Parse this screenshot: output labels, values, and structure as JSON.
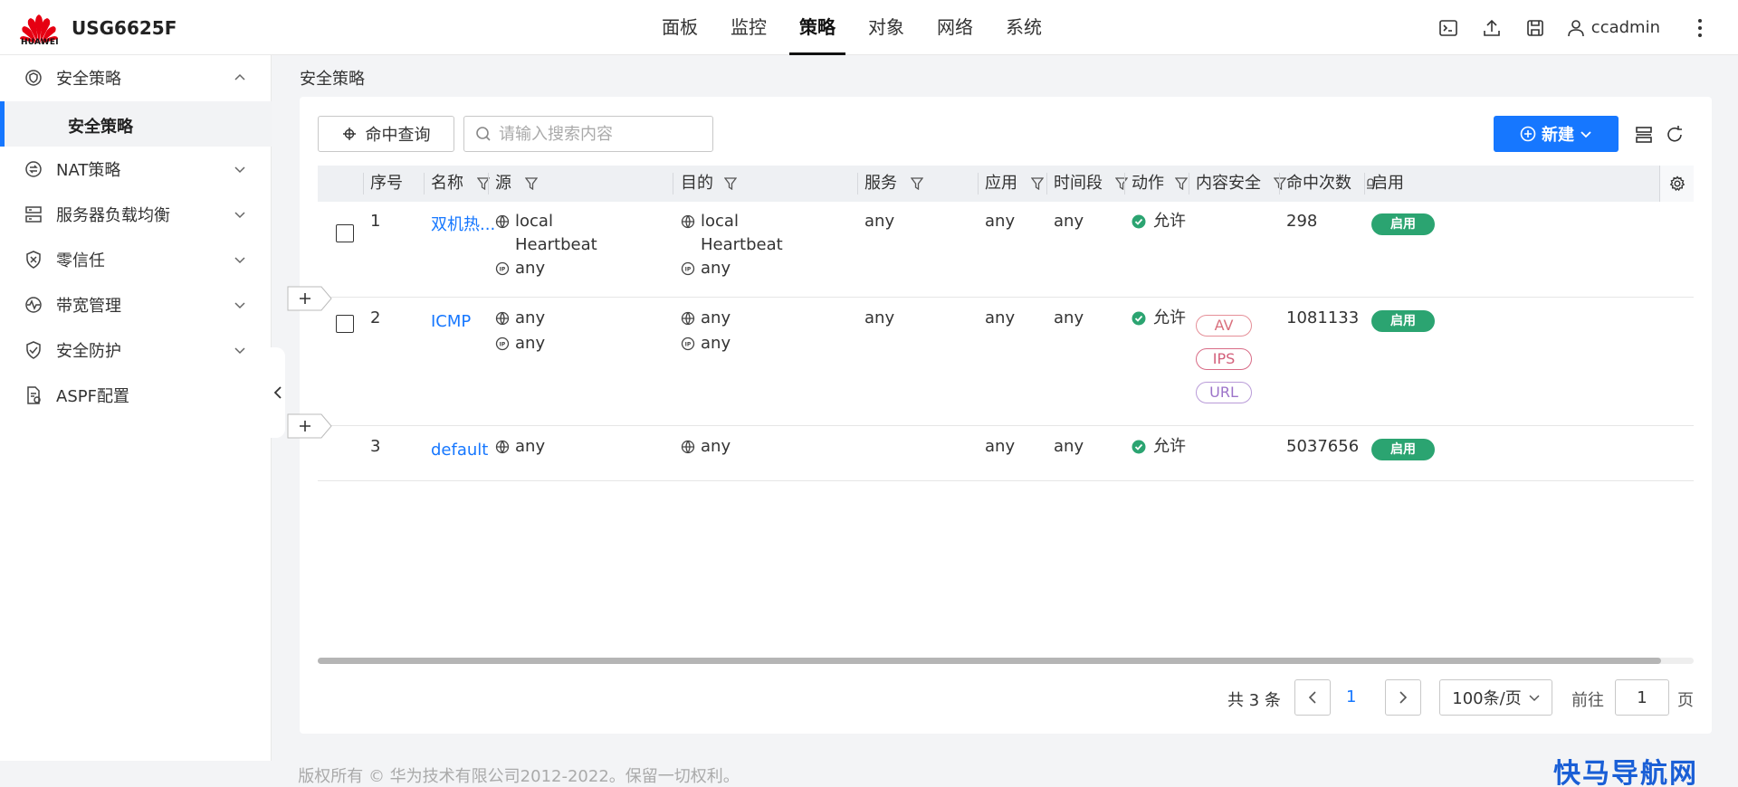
{
  "header": {
    "logo_text": "HUAWEI",
    "device_name": "USG6625F",
    "nav": [
      {
        "label": "面板",
        "active": false
      },
      {
        "label": "监控",
        "active": false
      },
      {
        "label": "策略",
        "active": true
      },
      {
        "label": "对象",
        "active": false
      },
      {
        "label": "网络",
        "active": false
      },
      {
        "label": "系统",
        "active": false
      }
    ],
    "icons": [
      "terminal-icon",
      "upload-icon",
      "save-icon",
      "user-icon",
      "more-vertical-icon"
    ],
    "username": "ccadmin"
  },
  "sidebar": {
    "items": [
      {
        "label": "安全策略",
        "icon": "security-policy-icon",
        "expanded": true
      },
      {
        "label": "NAT策略",
        "icon": "nat-icon",
        "expanded": false
      },
      {
        "label": "服务器负载均衡",
        "icon": "server-lb-icon",
        "expanded": false
      },
      {
        "label": "零信任",
        "icon": "zero-trust-icon",
        "expanded": false
      },
      {
        "label": "带宽管理",
        "icon": "bandwidth-icon",
        "expanded": false
      },
      {
        "label": "安全防护",
        "icon": "shield-check-icon",
        "expanded": false
      },
      {
        "label": "ASPF配置",
        "icon": "aspf-icon",
        "expanded": null
      }
    ],
    "active_sub": "安全策略"
  },
  "breadcrumb": "安全策略",
  "toolbar": {
    "hit_query_label": "命中查询",
    "search_placeholder": "请输入搜索内容",
    "new_label": "新建"
  },
  "table": {
    "columns": [
      "序号",
      "名称",
      "源",
      "目的",
      "服务",
      "应用",
      "时间段",
      "动作",
      "内容安全",
      "命中次数",
      "启用"
    ],
    "rows": [
      {
        "index": "1",
        "name": "双机热...",
        "source": [
          "local",
          "Heartbeat",
          "any"
        ],
        "destination": [
          "local",
          "Heartbeat",
          "any"
        ],
        "service": "any",
        "application": "any",
        "time_range": "any",
        "action": "允许",
        "content_security": [],
        "hits": "298",
        "enabled": "启用"
      },
      {
        "index": "2",
        "name": "ICMP",
        "source": [
          "any",
          "any"
        ],
        "destination": [
          "any",
          "any"
        ],
        "service": "any",
        "application": "any",
        "time_range": "any",
        "action": "允许",
        "content_security": [
          "AV",
          "IPS",
          "URL"
        ],
        "hits": "1081133",
        "enabled": "启用"
      },
      {
        "index": "3",
        "name": "default",
        "source": [
          "any"
        ],
        "destination": [
          "any"
        ],
        "service": "",
        "application": "any",
        "time_range": "any",
        "action": "允许",
        "content_security": [],
        "hits": "5037656",
        "enabled": "启用"
      }
    ]
  },
  "pagination": {
    "total_text": "共 3 条",
    "current_page": "1",
    "page_size": "100条/页",
    "goto_label": "前往",
    "goto_value": "1",
    "page_suffix": "页"
  },
  "footer": "版权所有 © 华为技术有限公司2012-2022。保留一切权利。",
  "watermark": "快马导航网",
  "colors": {
    "primary": "#1677ff",
    "enable_green": "#2ba471",
    "brand_red": "#e60012"
  }
}
